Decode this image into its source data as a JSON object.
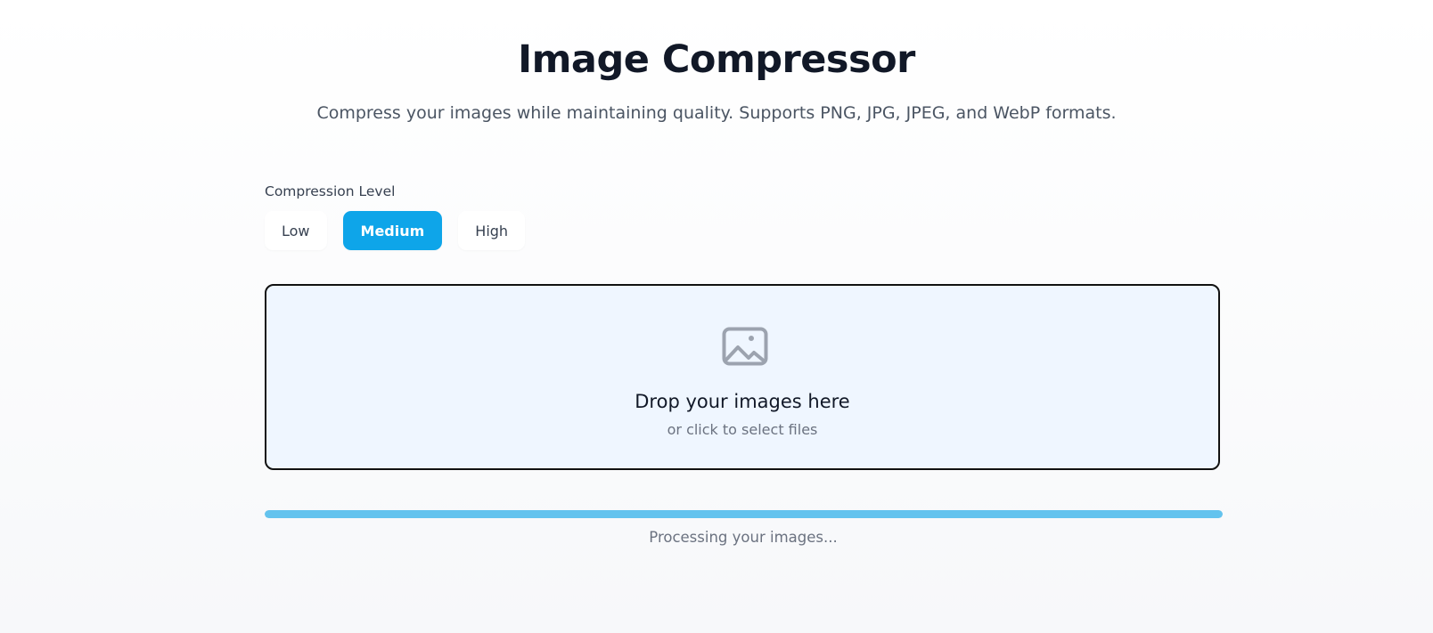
{
  "header": {
    "title": "Image Compressor",
    "subtitle": "Compress your images while maintaining quality. Supports PNG, JPG, JPEG, and WebP formats."
  },
  "compression": {
    "label": "Compression Level",
    "options": [
      {
        "label": "Low",
        "selected": false
      },
      {
        "label": "Medium",
        "selected": true
      },
      {
        "label": "High",
        "selected": false
      }
    ]
  },
  "dropzone": {
    "icon": "image-icon",
    "title": "Drop your images here",
    "hint": "or click to select files"
  },
  "progress": {
    "value": 1.0,
    "status_text": "Processing your images..."
  },
  "colors": {
    "accent": "#0ea5e9",
    "progress": "#63c3ee",
    "dropzone_background": "#eff6ff",
    "title": "#111827"
  }
}
